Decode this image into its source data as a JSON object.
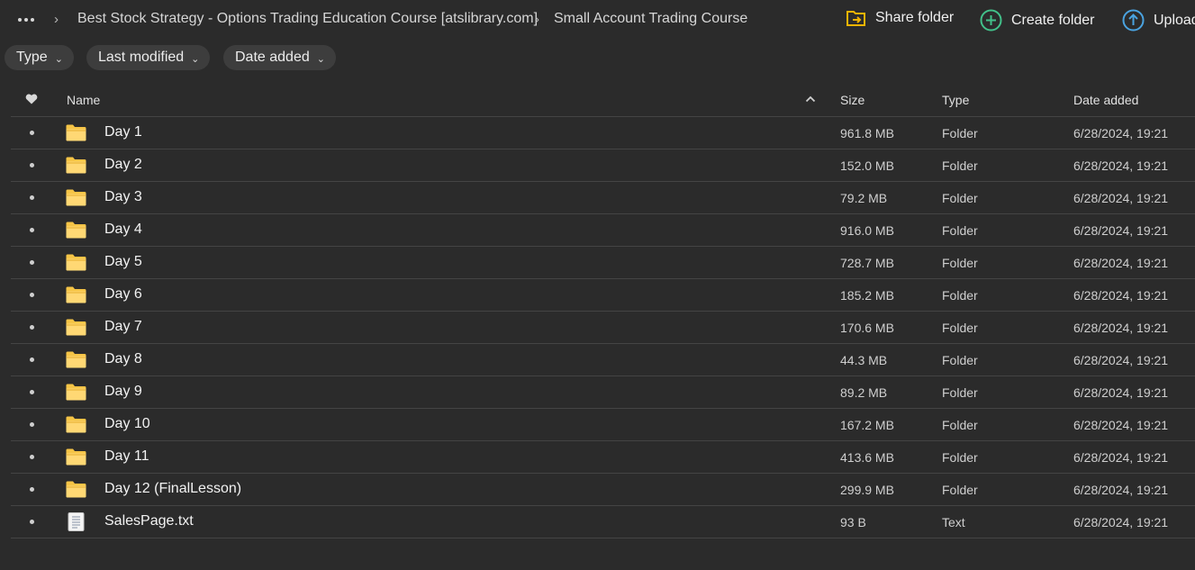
{
  "breadcrumb": {
    "more_icon": "more-horizontal-icon",
    "items": [
      "Best Stock Strategy - Options Trading Education Course [atslibrary.com]",
      "Small Account Trading Course"
    ]
  },
  "actions": {
    "share": {
      "label": "Share folder",
      "icon": "share-folder-icon",
      "color": "#f2b400"
    },
    "create": {
      "label": "Create folder",
      "icon": "plus-circle-icon",
      "color": "#42c08a"
    },
    "upload": {
      "label": "Upload",
      "icon": "upload-arrow-icon",
      "color": "#4aa3e0"
    }
  },
  "filters": [
    "Type",
    "Last modified",
    "Date added"
  ],
  "table": {
    "headers": {
      "favorite_icon": "heart-icon",
      "name": "Name",
      "size": "Size",
      "type": "Type",
      "date": "Date added"
    },
    "sort": {
      "column": "Name",
      "direction": "ascending"
    },
    "rows": [
      {
        "name": "Day 1",
        "size": "961.8 MB",
        "type": "Folder",
        "date": "6/28/2024, 19:21",
        "icon": "folder-icon"
      },
      {
        "name": "Day 2",
        "size": "152.0 MB",
        "type": "Folder",
        "date": "6/28/2024, 19:21",
        "icon": "folder-icon"
      },
      {
        "name": "Day 3",
        "size": "79.2 MB",
        "type": "Folder",
        "date": "6/28/2024, 19:21",
        "icon": "folder-icon"
      },
      {
        "name": "Day 4",
        "size": "916.0 MB",
        "type": "Folder",
        "date": "6/28/2024, 19:21",
        "icon": "folder-icon"
      },
      {
        "name": "Day 5",
        "size": "728.7 MB",
        "type": "Folder",
        "date": "6/28/2024, 19:21",
        "icon": "folder-icon"
      },
      {
        "name": "Day 6",
        "size": "185.2 MB",
        "type": "Folder",
        "date": "6/28/2024, 19:21",
        "icon": "folder-icon"
      },
      {
        "name": "Day 7",
        "size": "170.6 MB",
        "type": "Folder",
        "date": "6/28/2024, 19:21",
        "icon": "folder-icon"
      },
      {
        "name": "Day 8",
        "size": "44.3 MB",
        "type": "Folder",
        "date": "6/28/2024, 19:21",
        "icon": "folder-icon"
      },
      {
        "name": "Day 9",
        "size": "89.2 MB",
        "type": "Folder",
        "date": "6/28/2024, 19:21",
        "icon": "folder-icon"
      },
      {
        "name": "Day 10",
        "size": "167.2 MB",
        "type": "Folder",
        "date": "6/28/2024, 19:21",
        "icon": "folder-icon"
      },
      {
        "name": "Day 11",
        "size": "413.6 MB",
        "type": "Folder",
        "date": "6/28/2024, 19:21",
        "icon": "folder-icon"
      },
      {
        "name": "Day 12 (FinalLesson)",
        "size": "299.9 MB",
        "type": "Folder",
        "date": "6/28/2024, 19:21",
        "icon": "folder-icon"
      },
      {
        "name": "SalesPage.txt",
        "size": "93 B",
        "type": "Text",
        "date": "6/28/2024, 19:21",
        "icon": "text-file-icon"
      }
    ]
  }
}
